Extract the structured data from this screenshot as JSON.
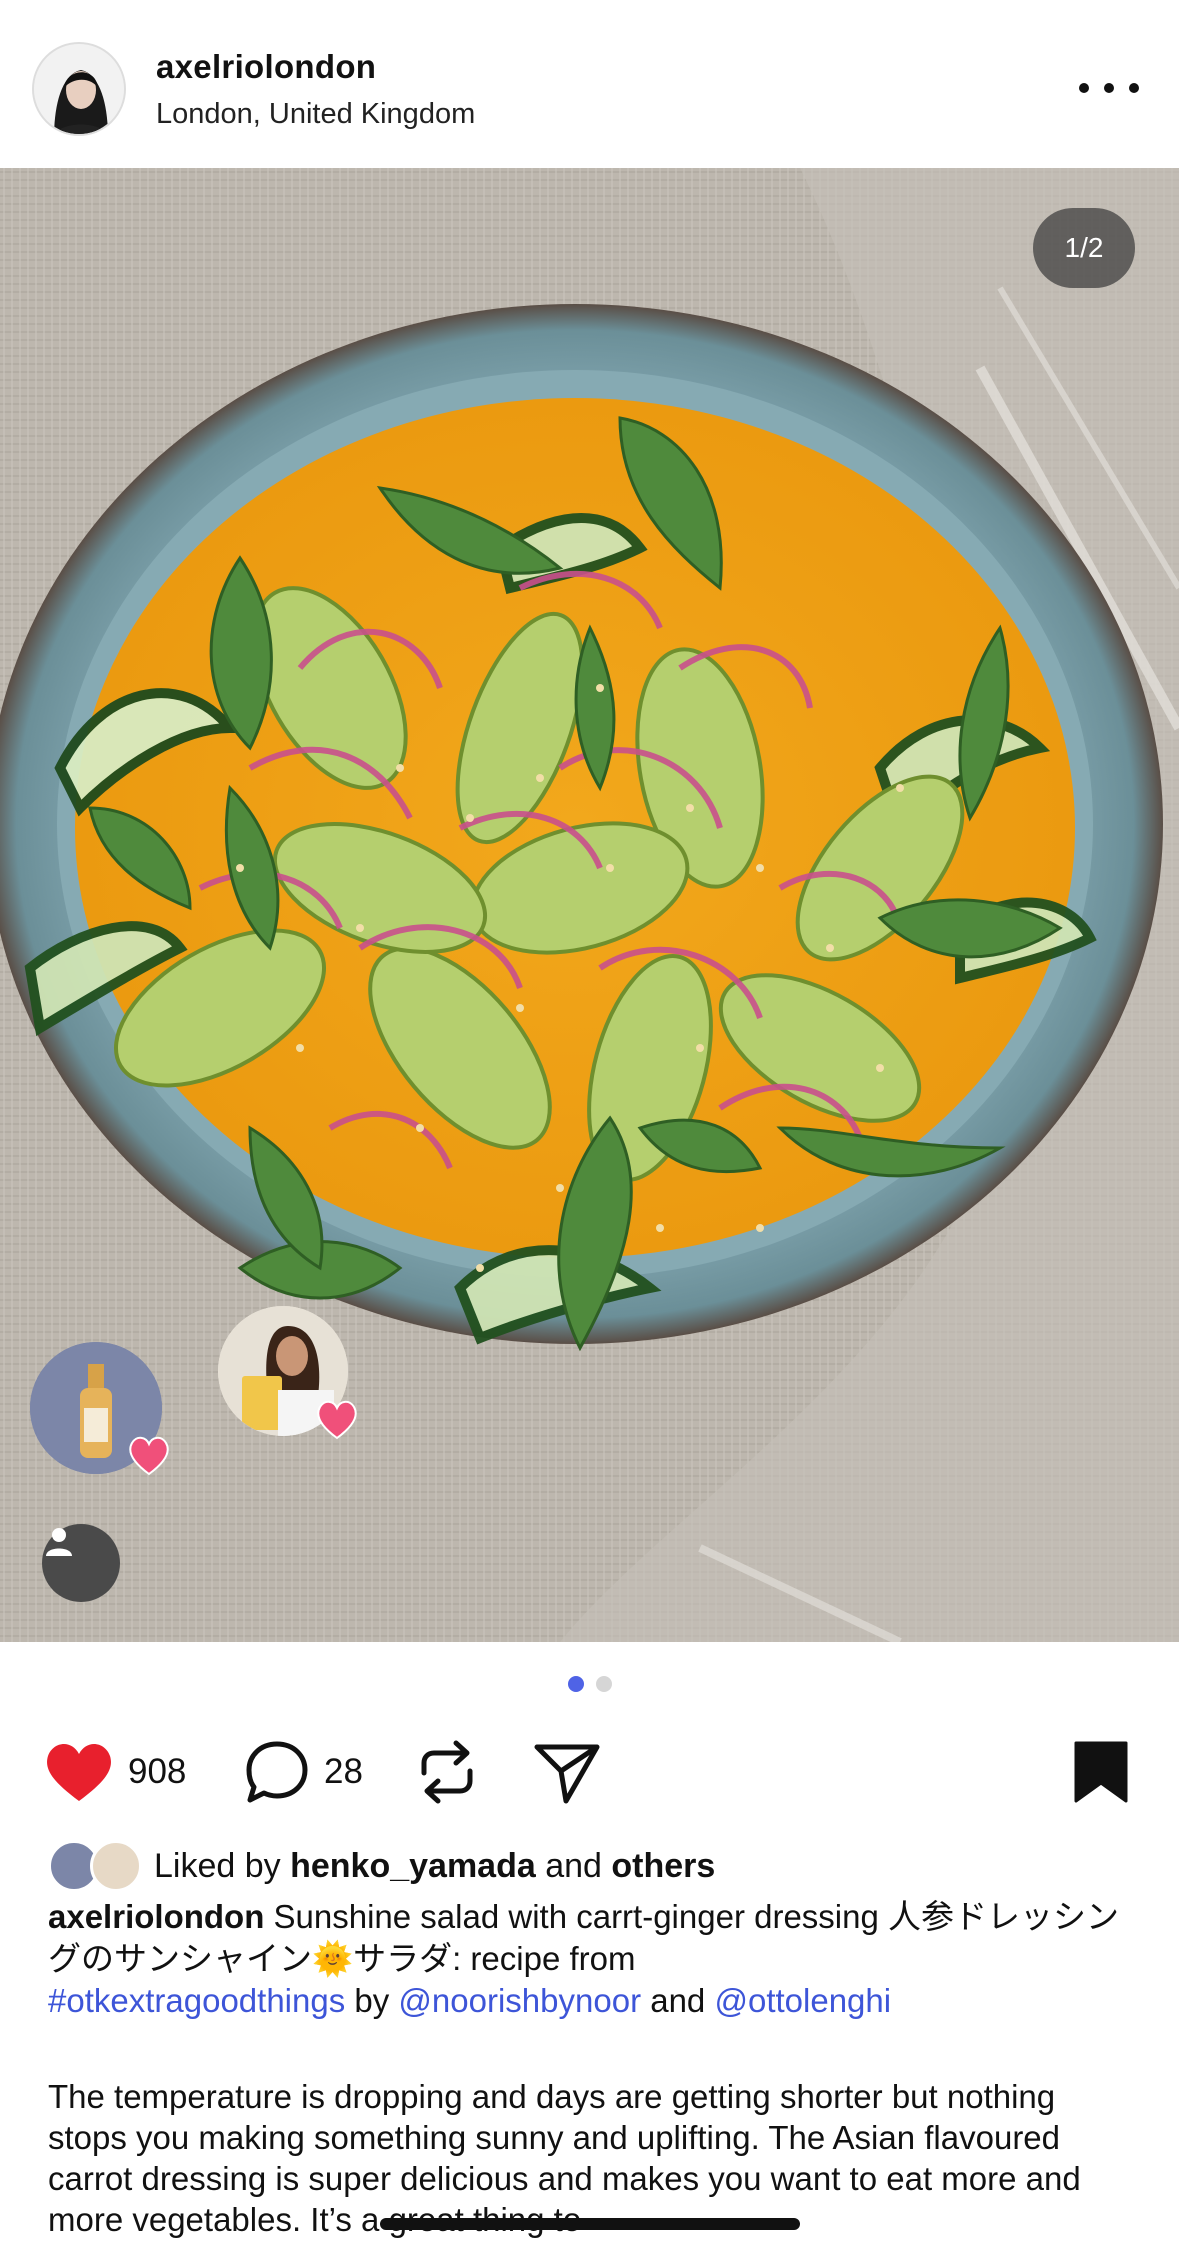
{
  "post_header": {
    "username": "axelriolondon",
    "location": "London, United Kingdom",
    "more_icon": "ellipsis-icon"
  },
  "photo": {
    "counter": "1/2",
    "alt_subject": "salad-photo"
  },
  "pager": {
    "current": 1,
    "total": 2
  },
  "actions": {
    "like_count": "908",
    "comment_count": "28",
    "icons": [
      "heart-icon",
      "comment-icon",
      "repost-icon",
      "share-icon",
      "bookmark-icon"
    ],
    "heart_color": "#e8202d"
  },
  "likes": {
    "prefix": "Liked by ",
    "user": "henko_yamada",
    "middle": " and ",
    "others": "others"
  },
  "caption": {
    "author": "axelriolondon",
    "text1": " Sunshine salad with carrt-ginger dressing 人参ドレッシングのサンシャイン",
    "emoji": "🌞",
    "text2": "サラダ: recipe from ",
    "hashtag": "#otkextragoodthings",
    "by": " by ",
    "mention1": "@noorishbynoor",
    "and": " and ",
    "mention2": "@ottolenghi"
  },
  "body": {
    "text": "The temperature is dropping and days are getting shorter but nothing stops you making something sunny and uplifting. The Asian flavoured carrot dressing is super delicious and makes you want to eat more and more vegetables. It’s a great thing to"
  },
  "colors": {
    "link": "#3d55d8",
    "pager_active": "#4f63e6"
  }
}
